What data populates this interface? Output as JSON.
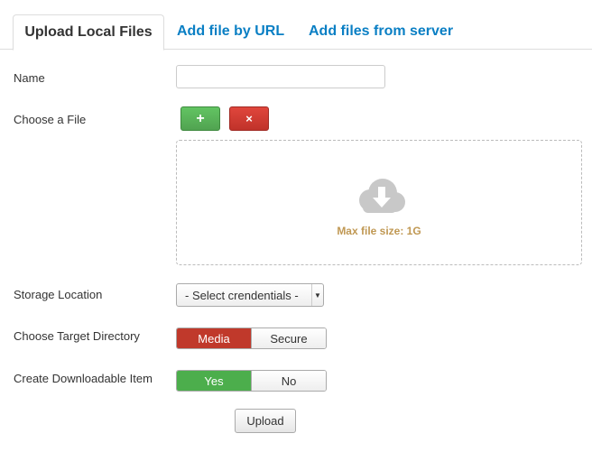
{
  "tabs": [
    {
      "label": "Upload Local Files",
      "active": true
    },
    {
      "label": "Add file by URL",
      "active": false
    },
    {
      "label": "Add files from server",
      "active": false
    }
  ],
  "form": {
    "name_label": "Name",
    "name_value": "",
    "choose_file_label": "Choose a File",
    "add_icon": "+",
    "remove_icon": "×",
    "dropzone_icon": "cloud-download-icon",
    "max_file_size": "Max file size: 1G",
    "storage_label": "Storage Location",
    "storage_selected": "- Select crendentials -",
    "target_dir_label": "Choose Target Directory",
    "target_dir_options": [
      "Media",
      "Secure"
    ],
    "target_dir_selected": "Media",
    "downloadable_label": "Create Downloadable Item",
    "downloadable_options": [
      "Yes",
      "No"
    ],
    "downloadable_selected": "Yes",
    "upload_label": "Upload"
  },
  "colors": {
    "link": "#0a7fc4",
    "success": "#4cae4c",
    "danger": "#c0392b",
    "warning_text": "#c09853"
  }
}
